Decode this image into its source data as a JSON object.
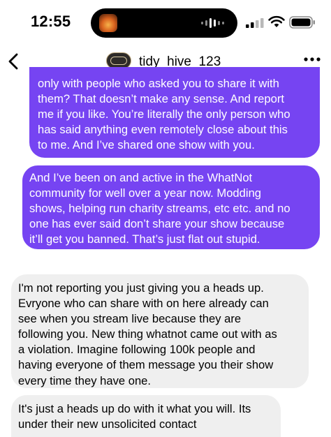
{
  "status_bar": {
    "time": "12:55",
    "island_icons": [
      "album-art-icon",
      "audio-waveform-icon"
    ],
    "icons": [
      "cellular-signal-icon",
      "wifi-icon",
      "battery-icon"
    ]
  },
  "header": {
    "back_icon": "chevron-left-icon",
    "username": "tidy_hive_123",
    "more_icon": "ellipsis-icon"
  },
  "colors": {
    "sent_bubble": "#7644f2",
    "received_bubble": "#efefef"
  },
  "messages": [
    {
      "direction": "sent",
      "text": "only with people who asked you to share it with\nthem? That doesn’t make any sense. And report\nme if you like. You’re literally the only person who\nhas said anything even remotely close about this\nto me. And I’ve shared one show with you."
    },
    {
      "direction": "sent",
      "text": "And I’ve been on and active in the WhatNot\ncommunity for well over a year now. Modding\nshows, helping run charity streams, etc etc. and no\none has ever said don’t share your show because\nit’ll get you banned. That’s just flat out stupid."
    },
    {
      "direction": "received",
      "text": "I'm not reporting you just giving you a heads up.\nEvryone who can share with on here already can\nsee when you stream live because they are\nfollowing you. New thing whatnot came out with as\na violation. Imagine following 100k people and\nhaving everyone of them message you their show\nevery time they have one."
    },
    {
      "direction": "received",
      "text": "It's just a heads up do with it what you will. Its\nunder their new unsolicited contact"
    }
  ]
}
